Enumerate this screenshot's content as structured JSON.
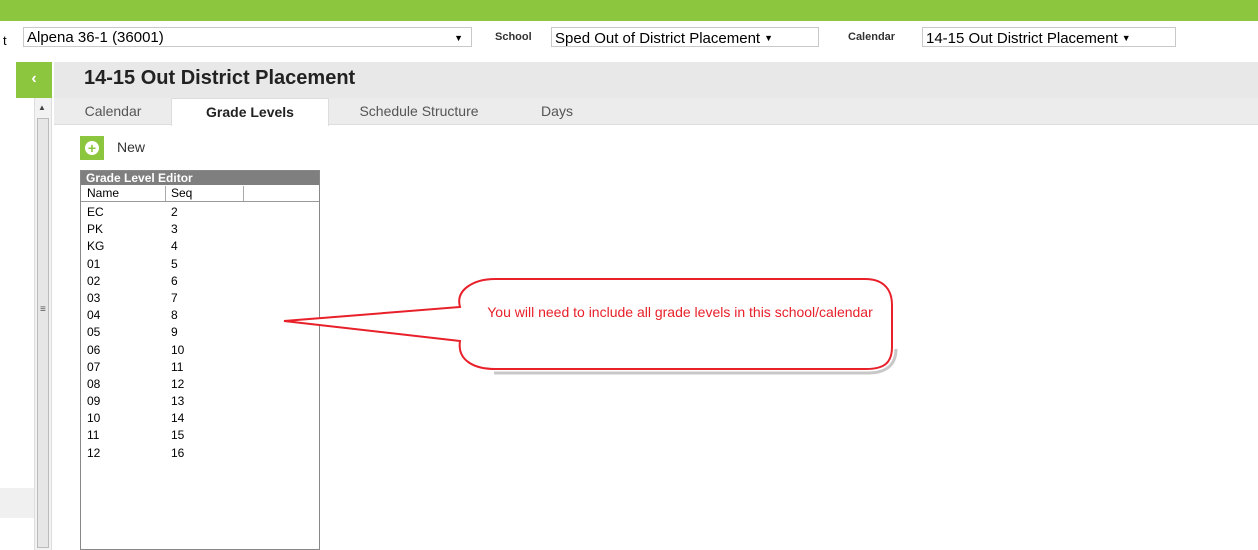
{
  "topbar": {
    "district_label_fragment": "t",
    "district_value": "Alpena 36-1 (36001)",
    "school_label": "School",
    "school_value": "Sped Out of District Placement",
    "calendar_label": "Calendar",
    "calendar_value": "14-15 Out District Placement"
  },
  "nav": {
    "collapse_glyph": "‹"
  },
  "header": {
    "title": "14-15 Out District Placement"
  },
  "tabs": [
    {
      "label": "Calendar"
    },
    {
      "label": "Grade Levels",
      "active": true
    },
    {
      "label": "Schedule Structure"
    },
    {
      "label": "Days"
    }
  ],
  "toolbar": {
    "new_label": "New"
  },
  "editor": {
    "title": "Grade Level Editor",
    "columns": [
      "Name",
      "Seq"
    ],
    "rows": [
      [
        "EC",
        "2"
      ],
      [
        "PK",
        "3"
      ],
      [
        "KG",
        "4"
      ],
      [
        "01",
        "5"
      ],
      [
        "02",
        "6"
      ],
      [
        "03",
        "7"
      ],
      [
        "04",
        "8"
      ],
      [
        "05",
        "9"
      ],
      [
        "06",
        "10"
      ],
      [
        "07",
        "11"
      ],
      [
        "08",
        "12"
      ],
      [
        "09",
        "13"
      ],
      [
        "10",
        "14"
      ],
      [
        "11",
        "15"
      ],
      [
        "12",
        "16"
      ]
    ]
  },
  "callout": {
    "text": "You will need to include all grade levels in this school/calendar"
  },
  "colors": {
    "accent_green": "#8cc63f",
    "callout_red": "#e8202a"
  }
}
